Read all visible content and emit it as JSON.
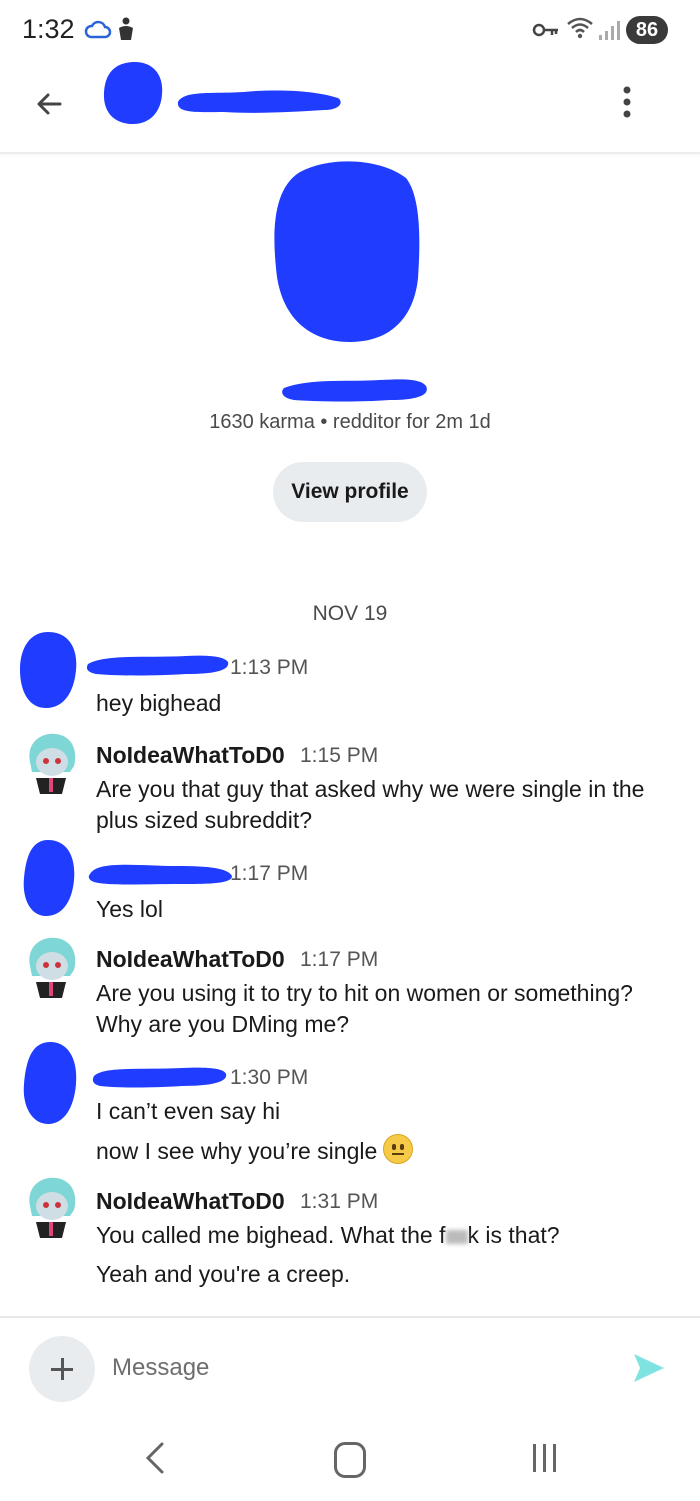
{
  "status_bar": {
    "time": "1:32",
    "battery": "86"
  },
  "header": {
    "back_icon": "arrow-left-icon",
    "more_icon": "more-vert-icon"
  },
  "profile": {
    "stats": "1630 karma • redditor for 2m 1d",
    "view_profile_label": "View profile"
  },
  "date_separator": "NOV 19",
  "messages": [
    {
      "username": "",
      "time": "1:13 PM",
      "lines": [
        "hey bighead"
      ]
    },
    {
      "username": "NoIdeaWhatToD0",
      "time": "1:15 PM",
      "lines": [
        "Are you that guy that asked why we were single in the plus sized subreddit?"
      ]
    },
    {
      "username": "",
      "time": "1:17 PM",
      "lines": [
        "Yes lol"
      ]
    },
    {
      "username": "NoIdeaWhatToD0",
      "time": "1:17 PM",
      "lines": [
        "Are you using it to try to hit on women or something? Why are you DMing me?"
      ]
    },
    {
      "username": "",
      "time": "1:30 PM",
      "lines": [
        "I can’t even say hi",
        "now I see why you’re single"
      ]
    },
    {
      "username": "NoIdeaWhatToD0",
      "time": "1:31 PM",
      "lines": [
        "You called me bighead. What the f",
        "k is that?",
        "Yeah and you're a creep."
      ]
    }
  ],
  "composer": {
    "placeholder": "Message"
  },
  "colors": {
    "redaction": "#1f3cff",
    "send": "#7fe3e0"
  }
}
